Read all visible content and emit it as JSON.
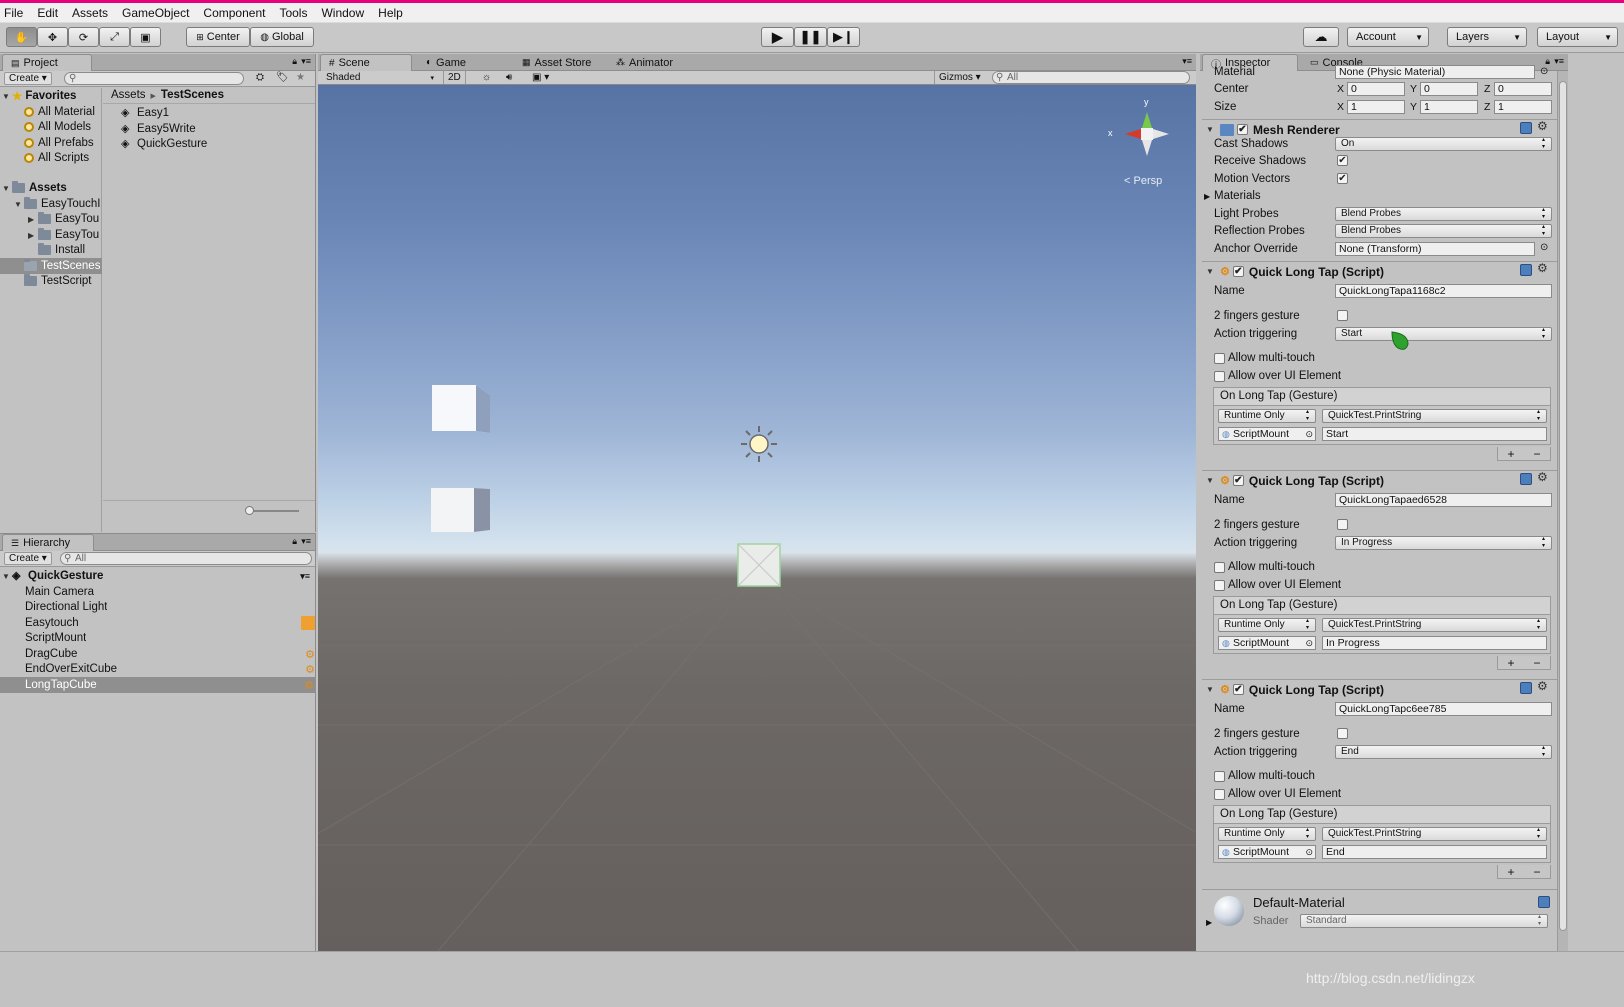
{
  "menu": [
    "File",
    "Edit",
    "Assets",
    "GameObject",
    "Component",
    "Tools",
    "Window",
    "Help"
  ],
  "toolbar": {
    "pivot": "Center",
    "space": "Global",
    "account": "Account",
    "layers": "Layers",
    "layout": "Layout"
  },
  "project": {
    "tab": "Project",
    "create": "Create",
    "favorites_title": "Favorites",
    "favorites": [
      "All Material",
      "All Models",
      "All Prefabs",
      "All Scripts"
    ],
    "assets_title": "Assets",
    "tree": [
      "EasyTouchI",
      "EasyTou",
      "EasyTou",
      "Install",
      "TestScenes",
      "TestScript"
    ],
    "breadcrumb_root": "Assets",
    "breadcrumb_current": "TestScenes",
    "files": [
      "Easy1",
      "Easy5Write",
      "QuickGesture"
    ]
  },
  "hierarchy": {
    "tab": "Hierarchy",
    "create": "Create",
    "search_placeholder": "All",
    "scene": "QuickGesture",
    "items": [
      "Main Camera",
      "Directional Light",
      "Easytouch",
      "ScriptMount",
      "DragCube",
      "EndOverExitCube",
      "LongTapCube"
    ]
  },
  "scene_view": {
    "tabs": [
      "Scene",
      "Game",
      "Asset Store",
      "Animator"
    ],
    "shading": "Shaded",
    "mode2d": "2D",
    "gizmos": "Gizmos",
    "search_placeholder": "All",
    "persp": "Persp",
    "gizmo_x": "x",
    "gizmo_y": "y"
  },
  "inspector": {
    "tabs": [
      "Inspector",
      "Console"
    ],
    "material_label": "Material",
    "material_value": "None (Physic Material)",
    "center_label": "Center",
    "size_label": "Size",
    "center": {
      "x": "0",
      "y": "0",
      "z": "0"
    },
    "size": {
      "x": "1",
      "y": "1",
      "z": "1"
    },
    "axes": [
      "X",
      "Y",
      "Z"
    ],
    "mesh_renderer": {
      "title": "Mesh Renderer",
      "cast_shadows_label": "Cast Shadows",
      "cast_shadows": "On",
      "receive_shadows_label": "Receive Shadows",
      "motion_vectors_label": "Motion Vectors",
      "materials_label": "Materials",
      "light_probes_label": "Light Probes",
      "light_probes": "Blend Probes",
      "reflection_probes_label": "Reflection Probes",
      "reflection_probes": "Blend Probes",
      "anchor_override_label": "Anchor Override",
      "anchor_override": "None (Transform)"
    },
    "labels": {
      "name": "Name",
      "two_fingers": "2 fingers gesture",
      "action_triggering": "Action triggering",
      "multi_touch": "Allow multi-touch",
      "over_ui": "Allow over UI Element",
      "event_title": "On Long Tap (Gesture)",
      "runtime": "Runtime Only",
      "function": "QuickTest.PrintString",
      "object": "ScriptMount"
    },
    "scripts": [
      {
        "title": "Quick Long Tap (Script)",
        "name": "QuickLongTapa1168c2",
        "action": "Start",
        "arg": "Start"
      },
      {
        "title": "Quick Long Tap (Script)",
        "name": "QuickLongTapaed6528",
        "action": "In Progress",
        "arg": "In Progress"
      },
      {
        "title": "Quick Long Tap (Script)",
        "name": "QuickLongTapc6ee785",
        "action": "End",
        "arg": "End"
      }
    ],
    "material": {
      "name": "Default-Material",
      "shader_label": "Shader",
      "shader": "Standard"
    }
  },
  "watermark": "http://blog.csdn.net/lidingzx",
  "colors": {
    "accent": "#e6007e",
    "selection": "#8f8f8f",
    "checkbox_on": "#333333"
  }
}
